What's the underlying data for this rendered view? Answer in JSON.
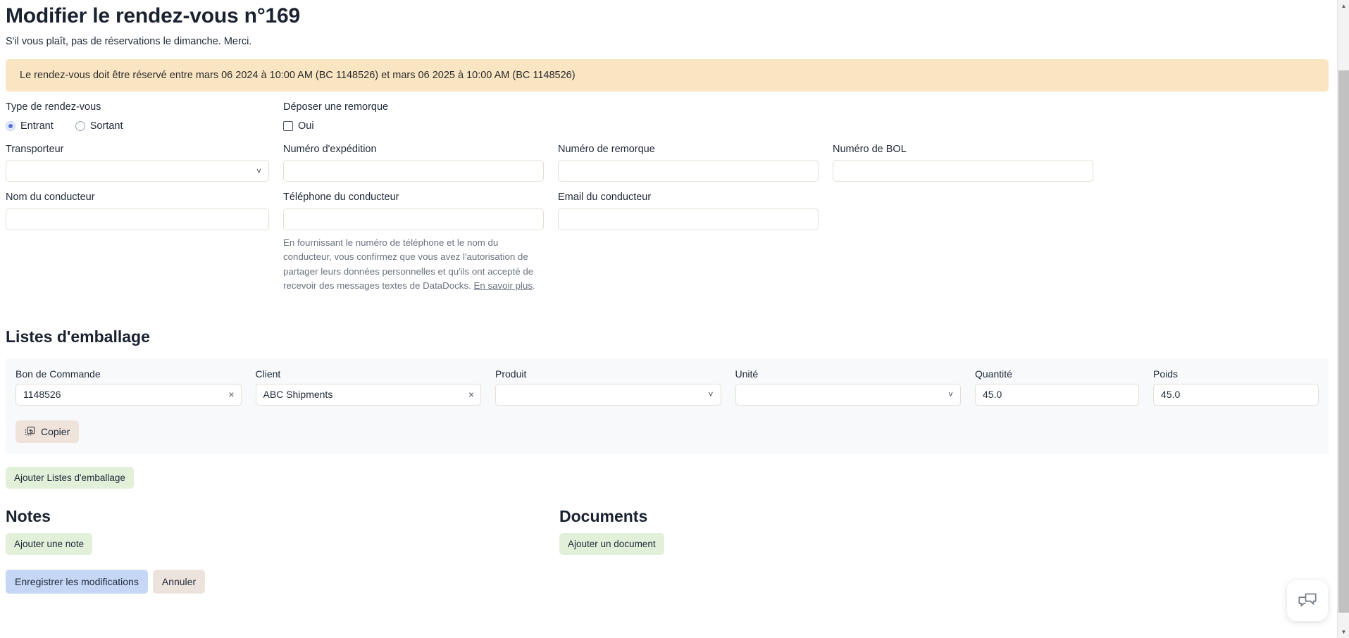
{
  "header": {
    "title": "Modifier le rendez-vous n°169",
    "subtitle": "S'il vous plaît, pas de réservations le dimanche. Merci."
  },
  "alert": {
    "message": "Le rendez-vous doit être réservé entre mars 06 2024 à 10:00 AM (BC 1148526) et mars 06 2025 à 10:00 AM (BC 1148526)",
    "background_color": "#fae5c3"
  },
  "appointment_type": {
    "label": "Type de rendez-vous",
    "options": [
      {
        "label": "Entrant",
        "selected": true
      },
      {
        "label": "Sortant",
        "selected": false
      }
    ]
  },
  "drop_trailer": {
    "label": "Déposer une remorque",
    "checkbox_label": "Oui",
    "checked": false
  },
  "fields": {
    "carrier": {
      "label": "Transporteur",
      "value": "",
      "type": "select"
    },
    "shipment_number": {
      "label": "Numéro d'expédition",
      "value": "",
      "type": "text"
    },
    "trailer_number": {
      "label": "Numéro de remorque",
      "value": "",
      "type": "text"
    },
    "bol_number": {
      "label": "Numéro de BOL",
      "value": "",
      "type": "text"
    },
    "driver_name": {
      "label": "Nom du conducteur",
      "value": "",
      "type": "text"
    },
    "driver_phone": {
      "label": "Téléphone du conducteur",
      "value": "",
      "type": "text"
    },
    "driver_email": {
      "label": "Email du conducteur",
      "value": "",
      "type": "text"
    }
  },
  "driver_consent": {
    "text": "En fournissant le numéro de téléphone et le nom du conducteur, vous confirmez que vous avez l'autorisation de partager leurs données personnelles et qu'ils ont accepté de recevoir des messages textes de DataDocks. ",
    "link_text": "En savoir plus",
    "trailing": "."
  },
  "packing_lists": {
    "title": "Listes d'emballage",
    "columns": {
      "purchase_order": "Bon de Commande",
      "customer": "Client",
      "product": "Produit",
      "unit": "Unité",
      "quantity": "Quantité",
      "weight": "Poids"
    },
    "row": {
      "purchase_order": "1148526",
      "customer": "ABC Shipments",
      "product": "",
      "unit": "",
      "quantity": "45.0",
      "weight": "45.0"
    },
    "clear_icon": "×",
    "copy_button": "Copier",
    "add_button": "Ajouter Listes d'emballage"
  },
  "notes": {
    "title": "Notes",
    "add_button": "Ajouter une note"
  },
  "documents": {
    "title": "Documents",
    "add_button": "Ajouter un document"
  },
  "actions": {
    "save": "Enregistrer les modifications",
    "cancel": "Annuler"
  },
  "chat": {
    "icon": "chat-bubbles-icon"
  },
  "colors": {
    "alert_bg": "#fae5c3",
    "save_bg": "#c6d6f5",
    "cancel_bg": "#ece3dc",
    "add_bg": "#e2efd9",
    "copy_bg": "#efe3dc",
    "panel_bg": "#f7f9fb",
    "radio_accent": "#4f6fd8"
  }
}
